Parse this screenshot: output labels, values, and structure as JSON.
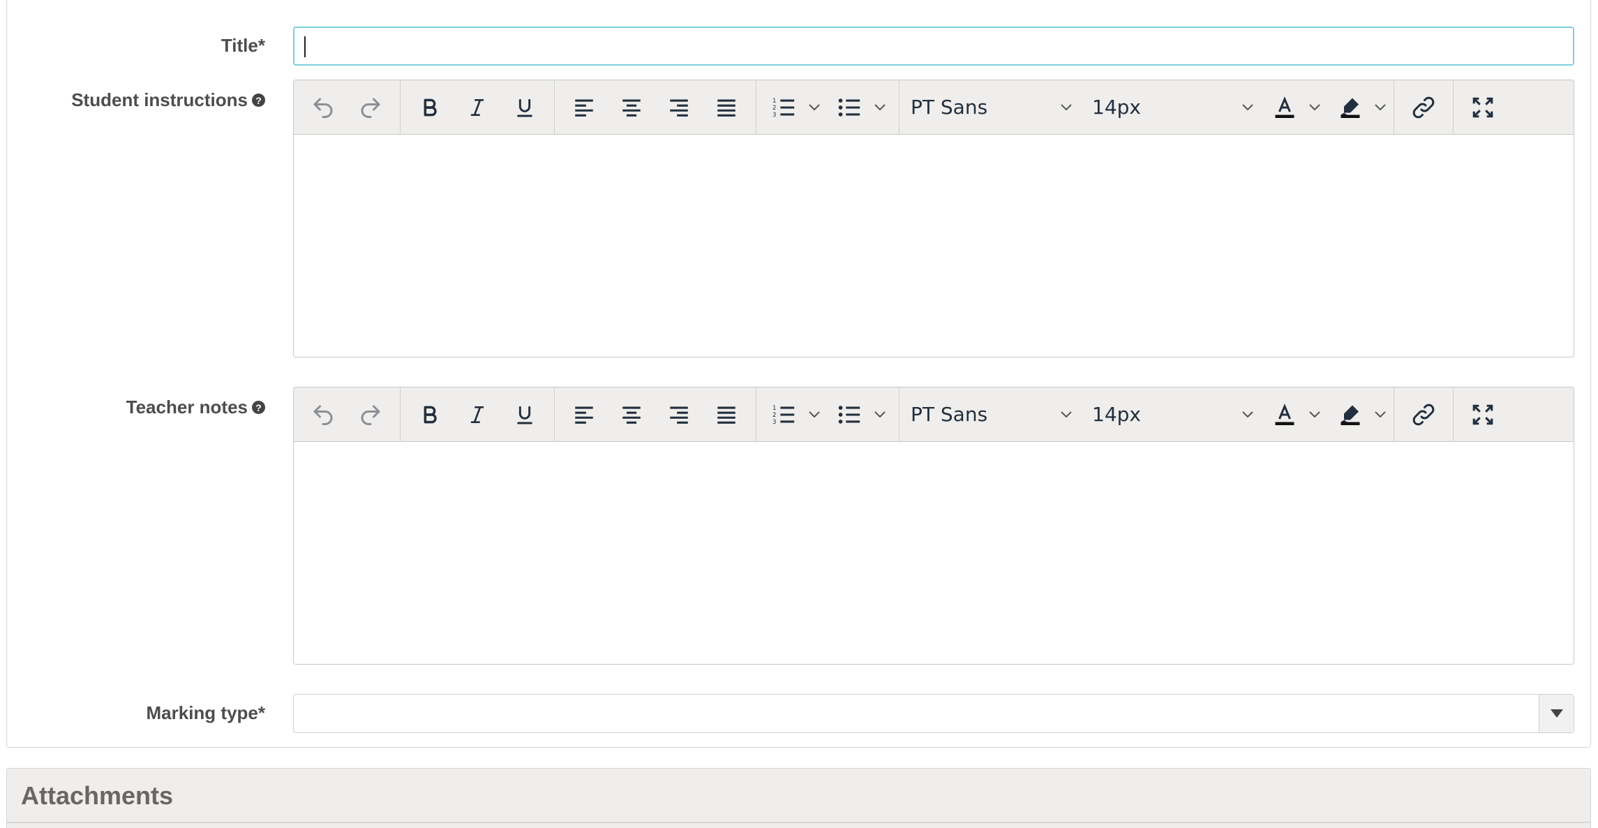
{
  "form": {
    "title_label": "Title*",
    "title_value": "",
    "student_instructions_label": "Student instructions",
    "teacher_notes_label": "Teacher notes",
    "marking_type_label": "Marking type*",
    "marking_type_value": "",
    "help_glyph": "?"
  },
  "editor_toolbar": {
    "font_family": "PT Sans",
    "font_size": "14px",
    "buttons": [
      "undo",
      "redo",
      "bold",
      "italic",
      "underline",
      "align-left",
      "align-center",
      "align-right",
      "justify",
      "numbered-list",
      "bullet-list",
      "text-color",
      "highlight-color",
      "link",
      "fullscreen"
    ]
  },
  "attachments": {
    "title": "Attachments"
  },
  "colors": {
    "focus_border": "#7ed0de",
    "toolbar_bg": "#efeeec",
    "icon": "#222f3e"
  }
}
